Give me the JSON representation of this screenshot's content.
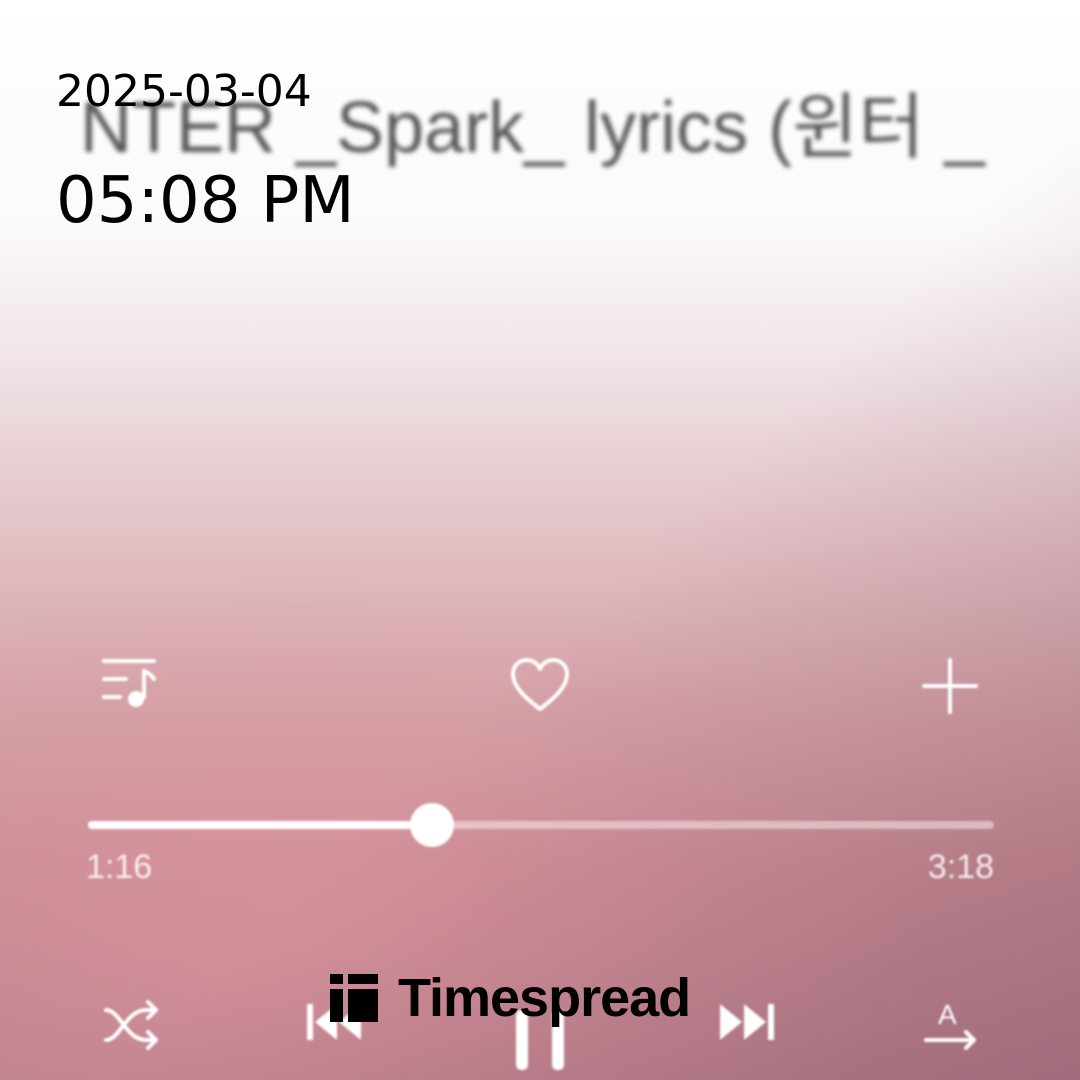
{
  "overlay": {
    "date": "2025-03-04",
    "time": "05:08 PM"
  },
  "player": {
    "song_title": "NTER _Spark_ lyrics (윈터 _",
    "elapsed": "1:16",
    "duration": "3:18",
    "progress_fraction": 0.38
  },
  "icons": {
    "playlist": "playlist-music-icon",
    "like": "heart-outline-icon",
    "add": "plus-icon",
    "shuffle": "shuffle-icon",
    "previous": "skip-previous-icon",
    "pause": "pause-icon",
    "next": "skip-next-icon",
    "translate": "translate-lyrics-icon"
  },
  "watermark": {
    "text": "Timespread"
  },
  "colors": {
    "accent": "#ffffff",
    "background_top": "#ffffff",
    "background_bottom": "#b9808d"
  }
}
